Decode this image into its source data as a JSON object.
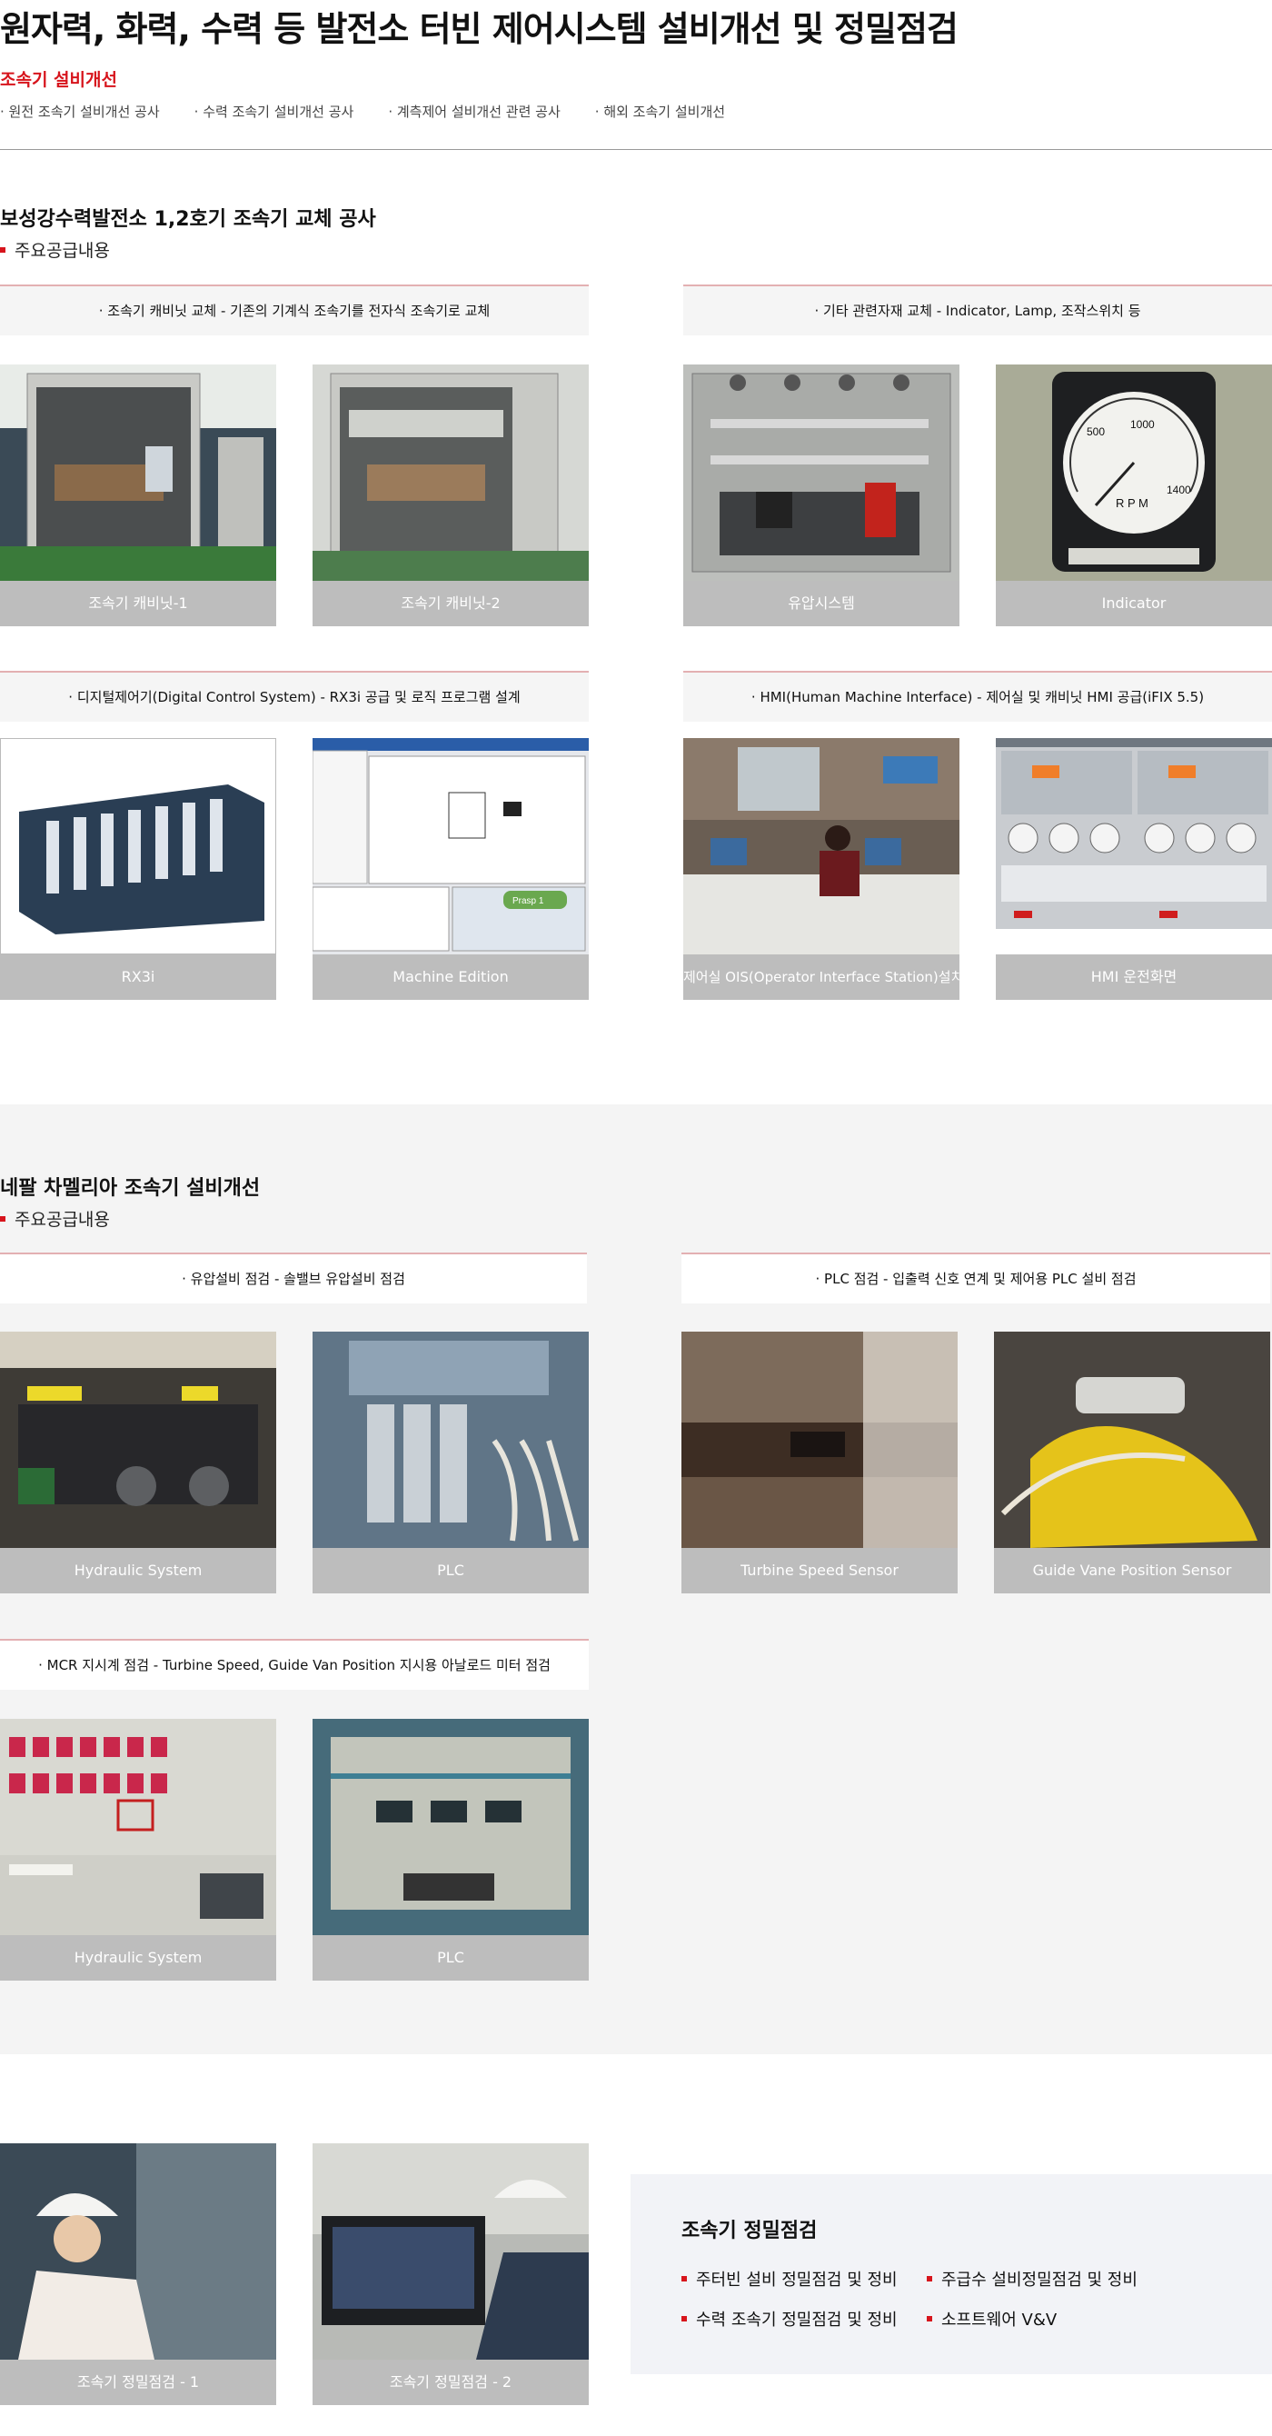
{
  "header": {
    "title": "원자력, 화력, 수력 등 발전소 터빈 제어시스템 설비개선 및 정밀점검",
    "accent": "조속기 설비개선",
    "links": [
      "원전 조속기 설비개선 공사",
      "수력 조속기 설비개선 공사",
      "계측제어 설비개선 관련 공사",
      "해외 조속기 설비개선"
    ]
  },
  "boseong": {
    "title": "보성강수력발전소 1,2호기 조속기 교체 공사",
    "sub": "주요공급내용",
    "bar1": "조속기 캐비닛 교체 - 기존의 기계식 조속기를 전자식 조속기로 교체",
    "bar2": "기타 관련자재 교체 - Indicator, Lamp, 조작스위치 등",
    "bar3": "디지털제어기(Digital Control System) - RX3i 공급 및 로직 프로그램 설계",
    "bar4": "HMI(Human Machine Interface) - 제어실 및 캐비닛 HMI 공급(iFIX 5.5)",
    "cards": [
      "조속기 캐비닛-1",
      "조속기 캐비닛-2",
      "유압시스템",
      "Indicator",
      "RX3i",
      "Machine Edition",
      "제어실 OIS(Operator Interface Station)설치",
      "HMI 운전화면"
    ]
  },
  "nepal": {
    "title": "네팔 차멜리아 조속기 설비개선",
    "sub": "주요공급내용",
    "bar1": "유압설비 점검 - 솔밸브 유압설비 점검",
    "bar2": "PLC 점검 - 입출력 신호 연계 및 제어용 PLC 설비 점검",
    "bar3": "MCR 지시계 점검 - Turbine Speed, Guide Van Position 지시용 아날로드 미터 점검",
    "cards": [
      "Hydraulic System",
      "PLC",
      "Turbine Speed Sensor",
      "Guide Vane Position Sensor",
      "Hydraulic System",
      "PLC"
    ]
  },
  "inspection": {
    "cards": [
      "조속기 정밀점검 - 1",
      "조속기 정밀점검 - 2"
    ],
    "title": "조속기 정밀점검",
    "items": [
      "주터빈 설비 정밀점검 및 정비",
      "주급수 설비정밀점검 및 정비",
      "수력 조속기 정밀점검 및 정비",
      "소프트웨어 V&V"
    ]
  },
  "images": {
    "rpm_gauge": {
      "labels": [
        "500",
        "1000",
        "1400",
        "R P M"
      ]
    },
    "plc_label": "Prasp 1"
  }
}
